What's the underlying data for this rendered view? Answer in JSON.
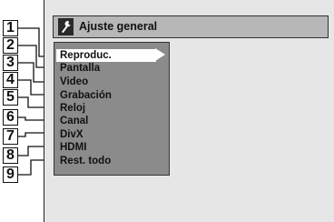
{
  "header": {
    "title": "Ajuste general",
    "icon": "wrench-icon"
  },
  "menu": {
    "items": [
      {
        "label": "Reproduc.",
        "selected": true
      },
      {
        "label": "Pantalla"
      },
      {
        "label": "Video"
      },
      {
        "label": "Grabación"
      },
      {
        "label": "Reloj"
      },
      {
        "label": "Canal"
      },
      {
        "label": "DivX"
      },
      {
        "label": "HDMI"
      },
      {
        "label": "Rest. todo"
      }
    ]
  },
  "callouts": [
    "1",
    "2",
    "3",
    "4",
    "5",
    "6",
    "7",
    "8",
    "9"
  ]
}
